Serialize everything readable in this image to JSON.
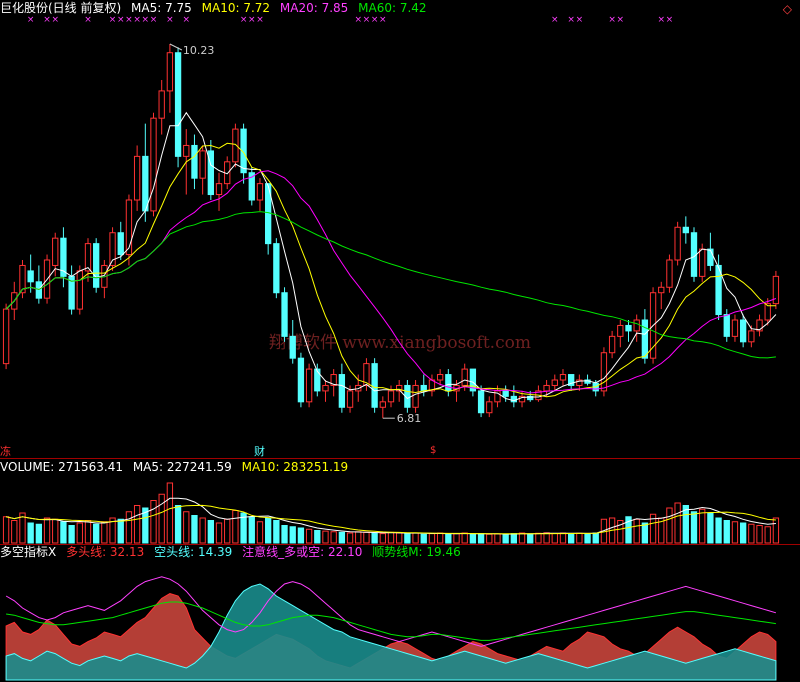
{
  "price_header": {
    "title": "巨化股份(日线 前复权)",
    "ma5": "MA5: 7.75",
    "ma10": "MA10: 7.72",
    "ma20": "MA20: 7.85",
    "ma60": "MA60: 7.42"
  },
  "volume_header": {
    "label": "VOLUME: 271563.41",
    "ma5": "MA5: 227241.59",
    "ma10": "MA10: 283251.19"
  },
  "indicator_header": {
    "name": "多空指标X",
    "long": "多头线: 32.13",
    "short": "空头线: 14.39",
    "attention": "注意线_多或空: 22.10",
    "trend": "顺势线M: 19.46"
  },
  "watermark": "翔博软件 www.xiangbosoft.com",
  "markers": {
    "left": "冻",
    "cai": "财",
    "dollar": "$"
  },
  "colors": {
    "up": "#ff3232",
    "down": "#54ffff",
    "ma5": "#ffffff",
    "ma10": "#ffff00",
    "ma20": "#ff00ff",
    "ma60": "#00e600",
    "long_fill": "#c8453c",
    "short_fill": "#1a8c8c",
    "attention": "#ff40ff",
    "trend": "#00e600"
  },
  "chart_data": [
    {
      "type": "candlestick",
      "high_label": "10.23",
      "low_label": "6.81",
      "ylim": [
        6.6,
        10.45
      ],
      "candles": [
        [
          7.3,
          7.85,
          7.25,
          7.8
        ],
        [
          7.8,
          8.05,
          7.7,
          7.95
        ],
        [
          7.95,
          8.25,
          7.9,
          8.2
        ],
        [
          8.15,
          8.3,
          7.95,
          8.05
        ],
        [
          8.05,
          8.2,
          7.85,
          7.9
        ],
        [
          7.9,
          8.3,
          7.85,
          8.25
        ],
        [
          8.2,
          8.5,
          8.1,
          8.45
        ],
        [
          8.45,
          8.55,
          8.0,
          8.1
        ],
        [
          8.1,
          8.2,
          7.75,
          7.8
        ],
        [
          7.8,
          8.2,
          7.75,
          8.15
        ],
        [
          8.15,
          8.45,
          8.05,
          8.4
        ],
        [
          8.4,
          8.45,
          7.95,
          8.0
        ],
        [
          8.0,
          8.25,
          7.9,
          8.2
        ],
        [
          8.2,
          8.55,
          8.15,
          8.5
        ],
        [
          8.5,
          8.6,
          8.25,
          8.3
        ],
        [
          8.3,
          8.85,
          8.2,
          8.8
        ],
        [
          8.8,
          9.3,
          8.7,
          9.2
        ],
        [
          9.2,
          9.5,
          8.6,
          8.7
        ],
        [
          8.7,
          9.6,
          8.65,
          9.55
        ],
        [
          9.55,
          9.9,
          9.4,
          9.8
        ],
        [
          9.8,
          10.23,
          9.6,
          10.15
        ],
        [
          10.15,
          10.2,
          9.1,
          9.2
        ],
        [
          9.2,
          9.45,
          8.85,
          9.3
        ],
        [
          9.3,
          9.4,
          8.9,
          9.0
        ],
        [
          9.0,
          9.3,
          8.85,
          9.25
        ],
        [
          9.25,
          9.35,
          8.8,
          8.85
        ],
        [
          8.85,
          9.05,
          8.7,
          8.95
        ],
        [
          8.95,
          9.2,
          8.9,
          9.15
        ],
        [
          9.15,
          9.5,
          9.1,
          9.45
        ],
        [
          9.45,
          9.5,
          8.95,
          9.05
        ],
        [
          9.05,
          9.1,
          8.75,
          8.8
        ],
        [
          8.8,
          9.0,
          8.7,
          8.95
        ],
        [
          8.95,
          8.95,
          8.3,
          8.4
        ],
        [
          8.4,
          8.45,
          7.9,
          7.95
        ],
        [
          7.95,
          8.0,
          7.5,
          7.55
        ],
        [
          7.55,
          7.7,
          7.3,
          7.35
        ],
        [
          7.35,
          7.4,
          6.9,
          6.95
        ],
        [
          6.95,
          7.3,
          6.9,
          7.25
        ],
        [
          7.25,
          7.3,
          7.0,
          7.05
        ],
        [
          7.05,
          7.15,
          6.95,
          7.1
        ],
        [
          7.1,
          7.25,
          7.0,
          7.2
        ],
        [
          7.2,
          7.3,
          6.85,
          6.9
        ],
        [
          6.9,
          7.1,
          6.85,
          7.05
        ],
        [
          7.05,
          7.2,
          6.95,
          7.1
        ],
        [
          7.1,
          7.35,
          7.05,
          7.3
        ],
        [
          7.3,
          7.35,
          6.85,
          6.9
        ],
        [
          6.9,
          7.0,
          6.8,
          6.95
        ],
        [
          6.95,
          7.1,
          6.9,
          7.05
        ],
        [
          7.05,
          7.15,
          6.95,
          7.1
        ],
        [
          7.1,
          7.15,
          6.85,
          6.9
        ],
        [
          6.9,
          7.15,
          6.85,
          7.1
        ],
        [
          7.1,
          7.2,
          7.0,
          7.05
        ],
        [
          7.05,
          7.2,
          7.0,
          7.15
        ],
        [
          7.15,
          7.25,
          7.1,
          7.2
        ],
        [
          7.2,
          7.25,
          7.0,
          7.05
        ],
        [
          7.05,
          7.15,
          6.95,
          7.1
        ],
        [
          7.1,
          7.3,
          7.05,
          7.25
        ],
        [
          7.25,
          7.25,
          7.0,
          7.05
        ],
        [
          7.05,
          7.1,
          6.81,
          6.85
        ],
        [
          6.85,
          7.0,
          6.81,
          6.95
        ],
        [
          6.95,
          7.1,
          6.9,
          7.05
        ],
        [
          7.05,
          7.1,
          6.95,
          7.0
        ],
        [
          7.0,
          7.1,
          6.9,
          6.95
        ],
        [
          6.95,
          7.05,
          6.9,
          7.0
        ],
        [
          7.0,
          7.05,
          6.95,
          6.97
        ],
        [
          6.97,
          7.1,
          6.95,
          7.05
        ],
        [
          7.05,
          7.15,
          7.0,
          7.1
        ],
        [
          7.1,
          7.2,
          7.05,
          7.15
        ],
        [
          7.15,
          7.25,
          7.1,
          7.2
        ],
        [
          7.2,
          7.2,
          7.05,
          7.1
        ],
        [
          7.1,
          7.2,
          7.05,
          7.15
        ],
        [
          7.15,
          7.2,
          7.1,
          7.12
        ],
        [
          7.12,
          7.15,
          7.0,
          7.05
        ],
        [
          7.05,
          7.45,
          7.0,
          7.4
        ],
        [
          7.4,
          7.6,
          7.35,
          7.55
        ],
        [
          7.55,
          7.7,
          7.45,
          7.65
        ],
        [
          7.65,
          7.7,
          7.5,
          7.6
        ],
        [
          7.6,
          7.75,
          7.5,
          7.7
        ],
        [
          7.7,
          7.8,
          7.3,
          7.35
        ],
        [
          7.35,
          8.0,
          7.3,
          7.95
        ],
        [
          7.95,
          8.05,
          7.8,
          8.0
        ],
        [
          8.0,
          8.3,
          7.95,
          8.25
        ],
        [
          8.25,
          8.6,
          8.2,
          8.55
        ],
        [
          8.55,
          8.65,
          8.4,
          8.5
        ],
        [
          8.5,
          8.55,
          8.05,
          8.1
        ],
        [
          8.1,
          8.4,
          8.05,
          8.35
        ],
        [
          8.35,
          8.5,
          8.15,
          8.2
        ],
        [
          8.2,
          8.3,
          7.7,
          7.75
        ],
        [
          7.75,
          7.8,
          7.5,
          7.55
        ],
        [
          7.55,
          7.75,
          7.5,
          7.7
        ],
        [
          7.7,
          7.75,
          7.45,
          7.5
        ],
        [
          7.5,
          7.65,
          7.45,
          7.6
        ],
        [
          7.6,
          7.75,
          7.55,
          7.7
        ],
        [
          7.7,
          7.9,
          7.65,
          7.85
        ],
        [
          7.85,
          8.15,
          7.8,
          8.1
        ]
      ]
    },
    {
      "type": "bar",
      "label": "VOLUME",
      "ylim": [
        0,
        520000
      ],
      "values": [
        210000,
        180000,
        240000,
        160000,
        150000,
        200000,
        190000,
        170000,
        140000,
        160000,
        180000,
        150000,
        170000,
        200000,
        190000,
        250000,
        300000,
        280000,
        340000,
        390000,
        480000,
        300000,
        250000,
        220000,
        200000,
        180000,
        160000,
        190000,
        260000,
        240000,
        210000,
        170000,
        200000,
        180000,
        140000,
        130000,
        120000,
        110000,
        100000,
        95000,
        90000,
        85000,
        80000,
        90000,
        85000,
        80000,
        75000,
        85000,
        80000,
        75000,
        80000,
        70000,
        75000,
        80000,
        70000,
        75000,
        80000,
        70000,
        75000,
        70000,
        72000,
        70000,
        75000,
        80000,
        72000,
        78000,
        82000,
        76000,
        80000,
        75000,
        78000,
        74000,
        80000,
        190000,
        200000,
        180000,
        210000,
        190000,
        160000,
        230000,
        200000,
        280000,
        320000,
        300000,
        250000,
        270000,
        240000,
        200000,
        180000,
        170000,
        160000,
        150000,
        140000,
        130000,
        200000
      ]
    },
    {
      "type": "area",
      "label": "多空指标X",
      "ylim": [
        0,
        100
      ],
      "series": [
        {
          "name": "多头线",
          "values": [
            45,
            48,
            40,
            38,
            42,
            50,
            46,
            38,
            30,
            28,
            32,
            35,
            40,
            38,
            36,
            42,
            48,
            52,
            60,
            68,
            72,
            70,
            60,
            42,
            35,
            28,
            24,
            20,
            18,
            22,
            26,
            30,
            34,
            38,
            36,
            34,
            30,
            26,
            20,
            16,
            14,
            12,
            10,
            14,
            18,
            22,
            26,
            30,
            32,
            30,
            26,
            22,
            18,
            16,
            20,
            24,
            28,
            32,
            30,
            26,
            22,
            20,
            18,
            16,
            20,
            24,
            28,
            26,
            24,
            30,
            34,
            40,
            38,
            36,
            30,
            26,
            24,
            20,
            22,
            28,
            34,
            40,
            44,
            40,
            36,
            30,
            26,
            20,
            18,
            24,
            30,
            36,
            40,
            38,
            32
          ]
        },
        {
          "name": "空头线",
          "values": [
            20,
            22,
            18,
            16,
            20,
            24,
            22,
            18,
            14,
            12,
            16,
            18,
            20,
            18,
            16,
            20,
            22,
            20,
            18,
            16,
            14,
            12,
            10,
            14,
            20,
            28,
            40,
            54,
            66,
            74,
            78,
            80,
            76,
            70,
            66,
            62,
            58,
            54,
            50,
            46,
            42,
            40,
            36,
            34,
            32,
            30,
            28,
            26,
            24,
            22,
            20,
            18,
            16,
            18,
            20,
            22,
            24,
            22,
            20,
            18,
            16,
            14,
            16,
            18,
            20,
            22,
            20,
            18,
            16,
            14,
            12,
            10,
            12,
            14,
            16,
            18,
            20,
            22,
            24,
            22,
            20,
            18,
            16,
            14,
            16,
            18,
            20,
            22,
            24,
            26,
            24,
            22,
            20,
            18,
            16
          ]
        },
        {
          "name": "注意线_多或空",
          "values": [
            70,
            66,
            60,
            56,
            52,
            50,
            52,
            56,
            58,
            60,
            62,
            60,
            58,
            62,
            66,
            72,
            78,
            82,
            84,
            86,
            84,
            80,
            74,
            66,
            58,
            52,
            46,
            42,
            40,
            42,
            48,
            56,
            66,
            74,
            80,
            82,
            80,
            76,
            70,
            64,
            58,
            52,
            46,
            42,
            40,
            38,
            36,
            34,
            32,
            34,
            36,
            38,
            40,
            38,
            36,
            34,
            32,
            30,
            28,
            30,
            32,
            34,
            36,
            38,
            40,
            42,
            44,
            46,
            48,
            50,
            52,
            54,
            56,
            58,
            60,
            62,
            64,
            66,
            68,
            70,
            72,
            74,
            76,
            78,
            76,
            74,
            72,
            70,
            68,
            66,
            64,
            62,
            60,
            58,
            56
          ]
        },
        {
          "name": "顺势线M",
          "values": [
            55,
            54,
            52,
            50,
            48,
            47,
            46,
            46,
            47,
            48,
            49,
            50,
            51,
            52,
            54,
            56,
            58,
            60,
            62,
            64,
            65,
            65,
            64,
            62,
            60,
            57,
            54,
            51,
            48,
            46,
            45,
            45,
            46,
            48,
            50,
            52,
            53,
            54,
            54,
            53,
            52,
            50,
            48,
            46,
            44,
            42,
            40,
            38,
            37,
            36,
            36,
            37,
            38,
            38,
            37,
            36,
            35,
            34,
            33,
            33,
            34,
            35,
            36,
            37,
            38,
            39,
            40,
            41,
            42,
            43,
            44,
            45,
            46,
            47,
            48,
            49,
            50,
            51,
            52,
            53,
            54,
            55,
            56,
            57,
            57,
            56,
            55,
            54,
            53,
            52,
            51,
            50,
            49,
            48,
            47
          ]
        }
      ]
    }
  ]
}
